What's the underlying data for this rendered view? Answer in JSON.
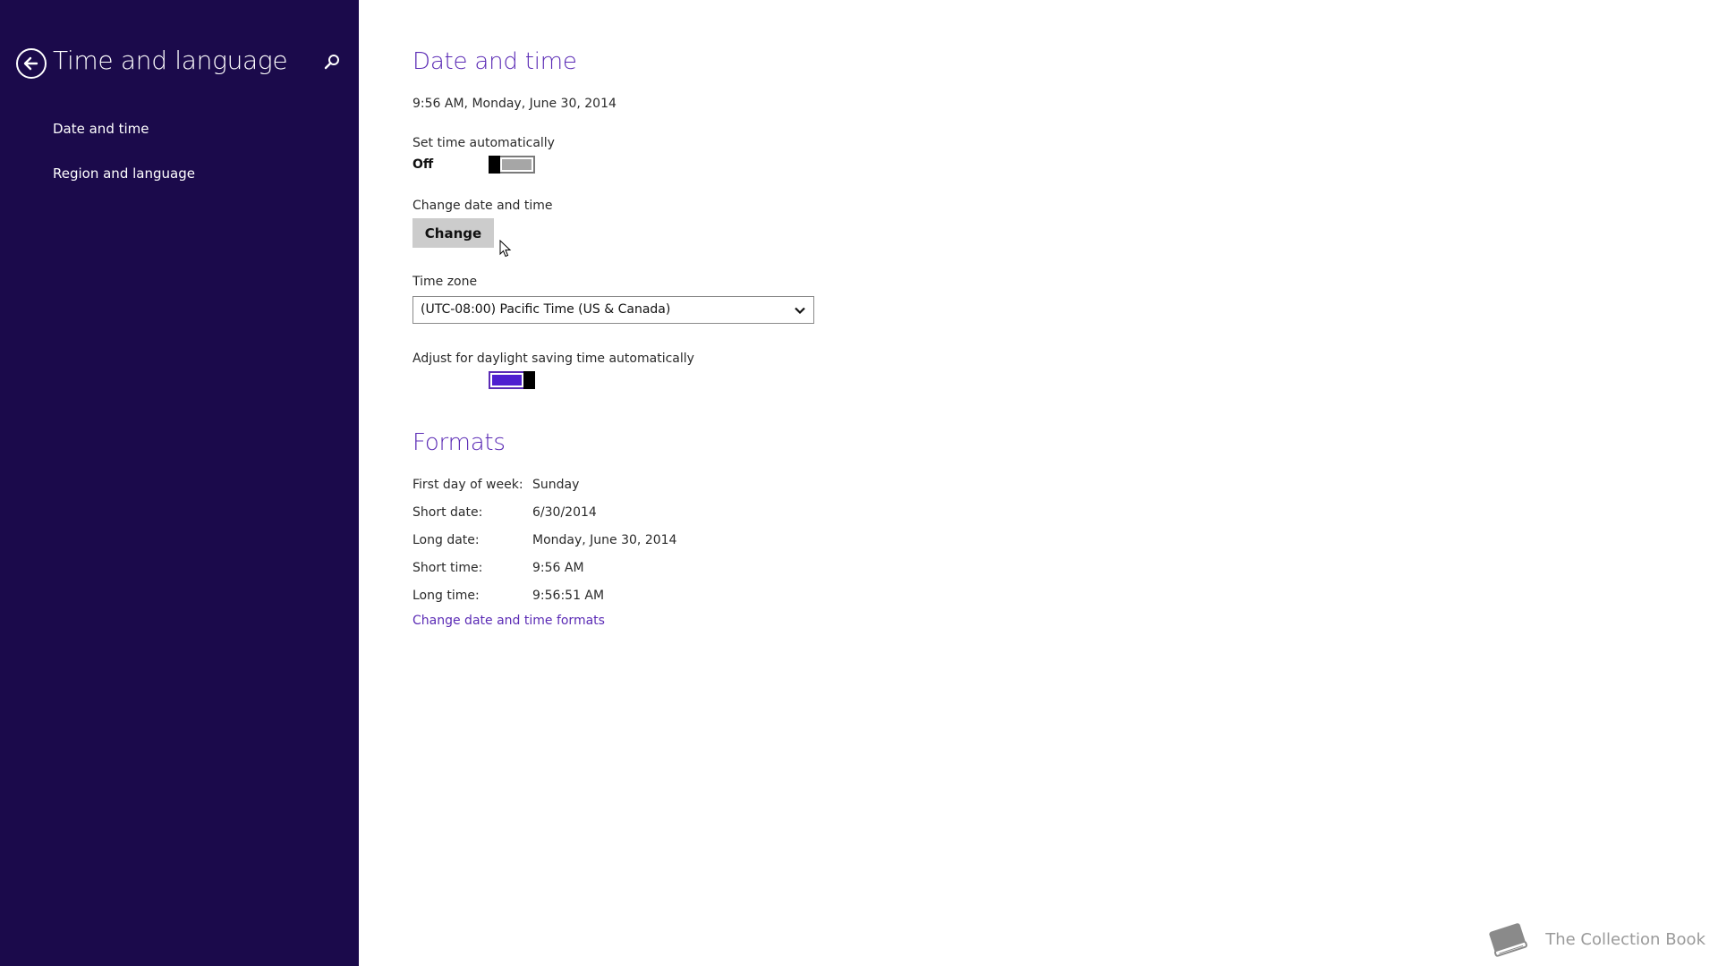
{
  "sidebar": {
    "title": "Time and language",
    "items": [
      {
        "label": "Date and time"
      },
      {
        "label": "Region and language"
      }
    ]
  },
  "date_time": {
    "section_title": "Date and time",
    "current_datetime": "9:56 AM, Monday, June 30, 2014",
    "set_time_auto_label": "Set time automatically",
    "set_time_auto_state": "Off",
    "set_time_auto_on": false,
    "change_label": "Change date and time",
    "change_button": "Change",
    "timezone_label": "Time zone",
    "timezone_value": "(UTC-08:00) Pacific Time (US & Canada)",
    "dst_label": "Adjust for daylight saving time automatically",
    "dst_on": true
  },
  "formats": {
    "section_title": "Formats",
    "rows": [
      {
        "label": "First day of week:",
        "value": "Sunday"
      },
      {
        "label": "Short date:",
        "value": "6/30/2014"
      },
      {
        "label": "Long date:",
        "value": "Monday, June 30, 2014"
      },
      {
        "label": "Short time:",
        "value": "9:56 AM"
      },
      {
        "label": "Long time:",
        "value": "9:56:51 AM"
      }
    ],
    "link": "Change date and time formats"
  },
  "watermark": {
    "text": "The Collection Book"
  },
  "colors": {
    "sidebar_bg": "#1b0a4b",
    "accent": "#5b2bb5",
    "toggle_on": "#4f1fd0",
    "toggle_off": "#a6a6a6"
  }
}
